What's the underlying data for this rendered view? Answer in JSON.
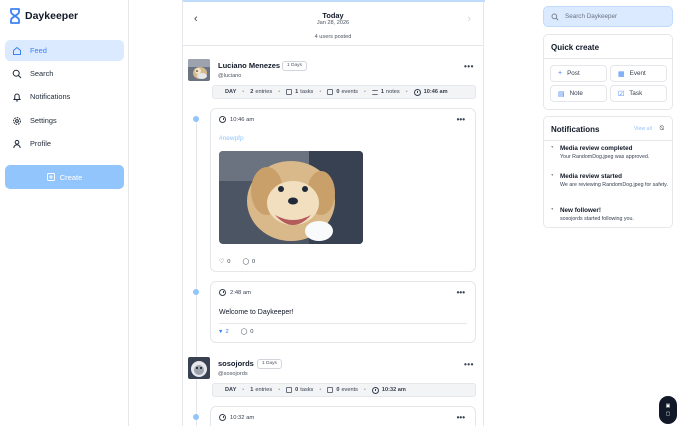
{
  "app": {
    "name": "Daykeeper"
  },
  "sidebar": {
    "items": [
      {
        "label": "Feed",
        "icon": "home-icon"
      },
      {
        "label": "Search",
        "icon": "search-icon"
      },
      {
        "label": "Notifications",
        "icon": "bell-icon"
      },
      {
        "label": "Settings",
        "icon": "gear-icon"
      },
      {
        "label": "Profile",
        "icon": "user-icon"
      }
    ],
    "create_label": "Create"
  },
  "feed": {
    "title": "Today",
    "date": "Jan 28, 2026",
    "users_posted": "4 users posted",
    "users": [
      {
        "name": "Luciano Menezes",
        "handle": "@luciano",
        "days": "1 Days",
        "stats": {
          "day": "DAY",
          "entries": "2",
          "entries_label": "entries",
          "tasks": "1",
          "tasks_label": "tasks",
          "events": "0",
          "events_label": "events",
          "notes": "1",
          "notes_label": "notes",
          "time": "10:46 am"
        },
        "posts": [
          {
            "time": "10:46 am",
            "hashtag": "#newpfp",
            "likes": "0",
            "comments": "0"
          },
          {
            "time": "2:48 am",
            "text": "Welcome to Daykeeper!",
            "likes": "2",
            "comments": "0"
          }
        ]
      },
      {
        "name": "sosojords",
        "handle": "@sosojords",
        "days": "1 Days",
        "stats": {
          "day": "DAY",
          "entries": "1",
          "entries_label": "entries",
          "tasks": "0",
          "tasks_label": "tasks",
          "events": "0",
          "events_label": "events",
          "time": "10:32 am"
        },
        "posts": [
          {
            "time": "10:32 am"
          }
        ]
      }
    ]
  },
  "right": {
    "search_placeholder": "Search Daykeeper",
    "quick_create": {
      "title": "Quick create",
      "buttons": [
        "Post",
        "Event",
        "Note",
        "Task"
      ]
    },
    "notifications": {
      "title": "Notifications",
      "view_all": "View all",
      "items": [
        {
          "title": "Media review completed",
          "body": "Your RandomDog.jpeg was approved."
        },
        {
          "title": "Media review started",
          "body": "We are reviewing RandomDog.jpeg for safety."
        },
        {
          "title": "New follower!",
          "body": "sosojords started following you."
        }
      ]
    }
  },
  "colors": {
    "accent": "#3b82f6",
    "accent_light": "#dbeafe",
    "create_button": "#93c5fd"
  }
}
